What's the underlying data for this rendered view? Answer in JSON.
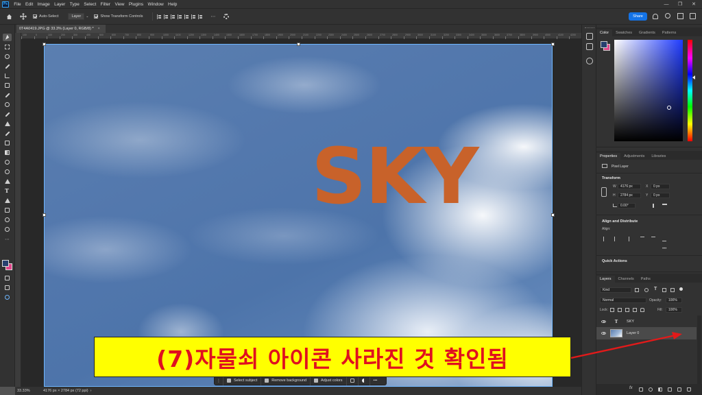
{
  "menu": {
    "app_badge": "Ps",
    "items": [
      "File",
      "Edit",
      "Image",
      "Layer",
      "Type",
      "Select",
      "Filter",
      "View",
      "Plugins",
      "Window",
      "Help"
    ]
  },
  "options": {
    "auto_select_label": "Auto-Select",
    "auto_select_target": "Layer",
    "transform_controls_label": "Show Transform Controls",
    "share_label": "Share"
  },
  "document": {
    "tab_title": "0T4A0419.JPG @ 33.3% (Layer 0, RGB/8) *",
    "close_glyph": "×"
  },
  "ruler": {
    "labels": [
      "100",
      "0",
      "100",
      "200",
      "300",
      "400",
      "500",
      "600",
      "700",
      "800",
      "900",
      "1000",
      "1100",
      "1200",
      "1300",
      "1400",
      "1500",
      "1600",
      "1700",
      "1800",
      "1900",
      "2000",
      "2100",
      "2200",
      "2300",
      "2400",
      "2500",
      "2600",
      "2700",
      "2800",
      "2900",
      "3000",
      "3100",
      "3200",
      "3300",
      "3400",
      "3500",
      "3600",
      "3700",
      "3800",
      "3900",
      "4000",
      "4100",
      "4200"
    ]
  },
  "canvas": {
    "text_layer_content": "SKY"
  },
  "annotation": {
    "text": "(7)자물쇠 아이콘 사라진 것 확인됨"
  },
  "contextual_bar": {
    "select_subject": "Select subject",
    "remove_background": "Remove background",
    "adjust_colors": "Adjust colors",
    "more": "•••"
  },
  "status": {
    "zoom": "33.33%",
    "doc_info": "4176 px × 2784 px (72 ppi)"
  },
  "color_panel": {
    "tabs": [
      "Color",
      "Swatches",
      "Gradients",
      "Patterns"
    ],
    "fg_color": "#27406f",
    "bg_color": "#e0468b"
  },
  "properties": {
    "tabs": [
      "Properties",
      "Adjustments",
      "Libraries"
    ],
    "kind": "Pixel Layer",
    "transform_heading": "Transform",
    "w_label": "W",
    "w_value": "4176 px",
    "h_label": "H",
    "h_value": "2784 px",
    "x_label": "X",
    "x_value": "0 px",
    "y_label": "Y",
    "y_value": "0 px",
    "angle_value": "0.00°",
    "align_heading": "Align and Distribute",
    "align_label": "Align:",
    "more_glyph": "•••",
    "quick_actions_heading": "Quick Actions"
  },
  "layers_panel": {
    "tabs": [
      "Layers",
      "Channels",
      "Paths"
    ],
    "filter_kind": "Kind",
    "blend_mode": "Normal",
    "opacity_label": "Opacity:",
    "opacity_value": "100%",
    "lock_label": "Lock:",
    "fill_label": "Fill:",
    "fill_value": "100%",
    "text_glyph": "T",
    "layers": [
      {
        "name": "SKY",
        "type": "text"
      },
      {
        "name": "Layer 0",
        "type": "pixel"
      }
    ]
  }
}
